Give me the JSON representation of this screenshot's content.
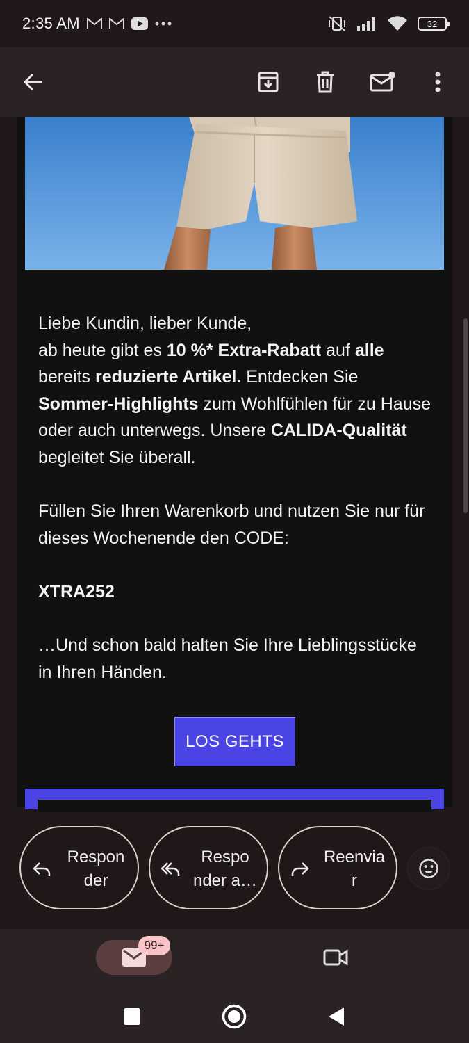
{
  "status_bar": {
    "time": "2:35 AM",
    "battery": "32",
    "icons": [
      "gmail-icon",
      "gmail-icon",
      "youtube-icon",
      "more-dots-icon",
      "vibrate-off-icon",
      "signal-icon",
      "wifi-icon",
      "battery-icon"
    ]
  },
  "app_bar": {
    "icons": [
      "back-arrow-icon",
      "archive-icon",
      "delete-icon",
      "mark-unread-icon",
      "more-vert-icon"
    ]
  },
  "email": {
    "greeting": "Liebe Kundin, lieber Kunde,",
    "p1_a": "ab heute gibt es ",
    "p1_b": "10 %* Extra-Rabatt",
    "p1_c": " auf ",
    "p1_d": "alle",
    "p1_e": " bereits ",
    "p1_f": "reduzierte Artikel.",
    "p1_g": " Entdecken Sie ",
    "p1_h": "Sommer-Highlights",
    "p1_i": " zum Wohlfühlen für zu Hause oder auch unterwegs. Unsere ",
    "p1_j": "CALIDA-Qualität",
    "p1_k": " begleitet Sie überall.",
    "p2": "Füllen Sie Ihren Warenkorb und nutzen Sie nur für dieses Wochenende den CODE:",
    "code": "XTRA252",
    "p3": "…Und schon bald halten Sie Ihre Lieblingsstücke in Ihren Händen.",
    "cta_label": "LOS GEHTS"
  },
  "reply_actions": {
    "reply": "Respon\nder",
    "reply_all": "Respo\nnder a…",
    "forward": "Reenvia\nr"
  },
  "bottom_nav": {
    "mail_badge": "99+"
  },
  "colors": {
    "accent": "#4a44e4",
    "background": "#1f1718",
    "card": "#111112",
    "badge": "#f7c5c8"
  }
}
